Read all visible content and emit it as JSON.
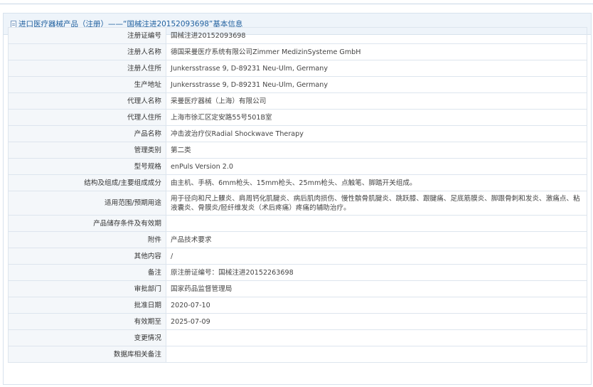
{
  "header": {
    "title": "进口医疗器械产品（注册）——“国械注进20152093698”基本信息"
  },
  "rows": [
    {
      "label": "注册证编号",
      "value": "国械注进20152093698"
    },
    {
      "label": "注册人名称",
      "value": "德国采曼医疗系统有限公司Zimmer MedizinSysteme GmbH"
    },
    {
      "label": "注册人住所",
      "value": "Junkersstrasse 9, D-89231 Neu-Ulm, Germany"
    },
    {
      "label": "生产地址",
      "value": "Junkersstrasse 9, D-89231 Neu-Ulm, Germany"
    },
    {
      "label": "代理人名称",
      "value": "采曼医疗器械（上海）有限公司"
    },
    {
      "label": "代理人住所",
      "value": "上海市徐汇区定安路55号501B室"
    },
    {
      "label": "产品名称",
      "value": "冲击波治疗仪Radial Shockwave Therapy"
    },
    {
      "label": "管理类别",
      "value": "第二类"
    },
    {
      "label": "型号规格",
      "value": "enPuls Version 2.0"
    },
    {
      "label": "结构及组成/主要组成成分",
      "value": "由主机、手柄、6mm枪头、15mm枪头、25mm枪头、点触笔、脚踏开关组成。"
    },
    {
      "label": "适用范围/预期用途",
      "value": "用于径向和尺上髁炎、肩周钙化肌腱炎、病后肌肉损伤、慢性髌骨肌腱炎、跳跃膝、跟腱痛、足底筋膜炎、脚跟骨刺和发炎、激痛点、粘液囊炎、骨膜炎/胫纤维发炎（术后疼痛）疼痛的辅助治疗。"
    },
    {
      "label": "产品储存条件及有效期",
      "value": ""
    },
    {
      "label": "附件",
      "value": "产品技术要求"
    },
    {
      "label": "其他内容",
      "value": "/"
    },
    {
      "label": "备注",
      "value": "原注册证编号：国械注进20152263698"
    },
    {
      "label": "审批部门",
      "value": "国家药品监督管理局"
    },
    {
      "label": "批准日期",
      "value": "2020-07-10"
    },
    {
      "label": "有效期至",
      "value": "2025-07-09"
    },
    {
      "label": "变更情况",
      "value": ""
    },
    {
      "label": "数据库相关备注",
      "value": ""
    }
  ]
}
